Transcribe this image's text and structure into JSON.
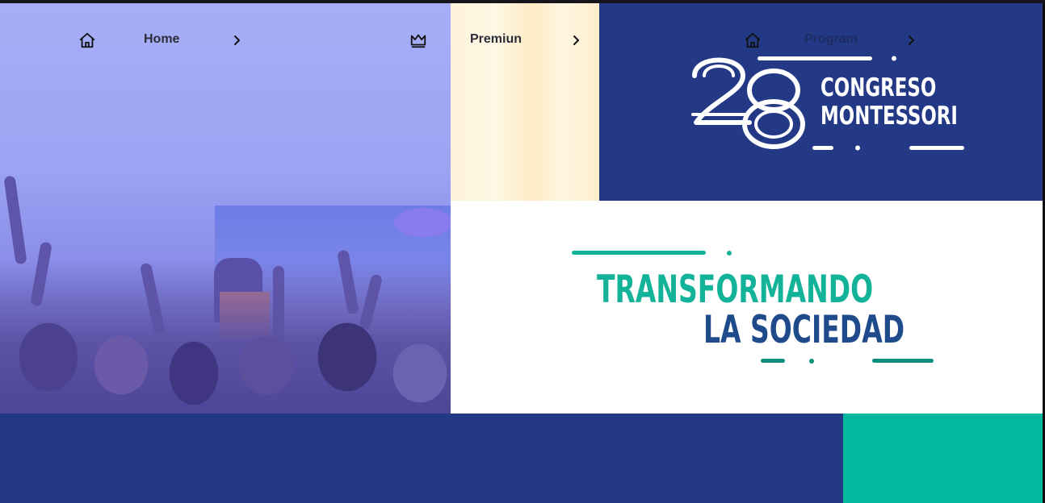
{
  "nav": {
    "items": [
      {
        "label": "Home",
        "icon": "home-icon"
      },
      {
        "label": "Premiun",
        "icon": "crown-icon"
      },
      {
        "label": "Program",
        "icon": "home-icon"
      }
    ]
  },
  "logo": {
    "number": "28",
    "line1": "CONGRESO",
    "line2": "MONTESSORI"
  },
  "tagline": {
    "line1": "TRANSFORMANDO",
    "line2": "LA SOCIEDAD"
  },
  "colors": {
    "navy": "#233985",
    "teal": "#04b79f",
    "tagline_teal": "#13b39a",
    "tagline_blue": "#1f4a8c"
  }
}
